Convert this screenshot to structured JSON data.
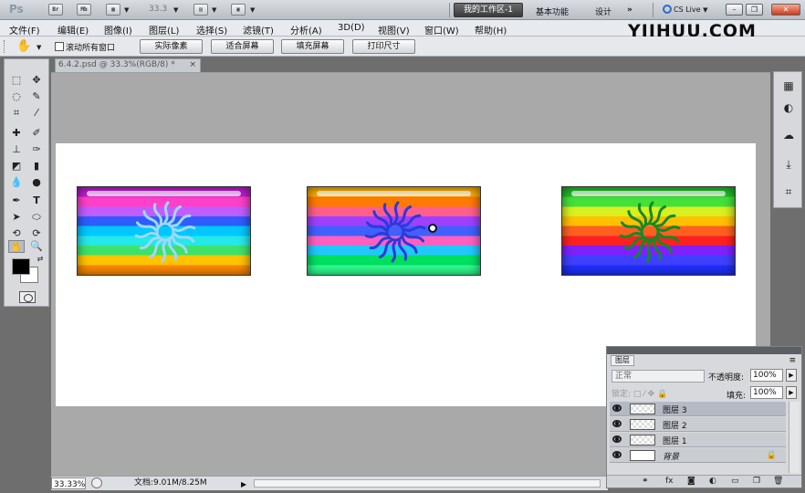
{
  "app": {
    "logo": "Ps",
    "zoom_dropdown": "33.3",
    "workspace_active": "我的工作区-1",
    "workspaces": [
      "基本功能",
      "设计"
    ],
    "overflow": "»",
    "cs_live": "CS Live"
  },
  "menu": [
    "文件(F)",
    "编辑(E)",
    "图像(I)",
    "图层(L)",
    "选择(S)",
    "滤镜(T)",
    "分析(A)",
    "3D(D)",
    "视图(V)",
    "窗口(W)",
    "帮助(H)"
  ],
  "watermark": "YIIHUU.COM",
  "options": {
    "scroll_all": "滚动所有窗口",
    "buttons": [
      "实际像素",
      "适合屏幕",
      "填充屏幕",
      "打印尺寸"
    ]
  },
  "document": {
    "tab_title": "6.4.2.psd @ 33.3%(RGB/8) *",
    "close": "×"
  },
  "flags": [
    {
      "name": "flag-1",
      "stripes": [
        "#c21cd6",
        "#ff40c8",
        "#c15cff",
        "#2e5cff",
        "#00c7ff",
        "#25e8e8",
        "#3de26a",
        "#ffc400",
        "#ff8a00"
      ],
      "sun_color": "#9fd8ff"
    },
    {
      "name": "flag-2",
      "stripes": [
        "#ffb000",
        "#ff7a00",
        "#ff5f8a",
        "#a040ff",
        "#4060ff",
        "#ff60c0",
        "#20c8ff",
        "#00e060",
        "#30ff90"
      ],
      "sun_color": "#2b3ad8"
    },
    {
      "name": "flag-3",
      "stripes": [
        "#20c02a",
        "#45e03a",
        "#d8f020",
        "#ffc000",
        "#ff6020",
        "#ff2020",
        "#8020ff",
        "#4040ff",
        "#2030ff"
      ],
      "sun_color": "#128a28"
    }
  ],
  "status": {
    "zoom": "33.33%",
    "doc": "文档:9.01M/8.25M"
  },
  "layers_panel": {
    "tab": "图层",
    "blend_mode": "正常",
    "opacity_label": "不透明度:",
    "opacity": "100%",
    "lock_label": "锁定:",
    "fill_label": "填充:",
    "fill": "100%",
    "layers": [
      {
        "name": "图层 3",
        "selected": true
      },
      {
        "name": "图层 2",
        "selected": false
      },
      {
        "name": "图层 1",
        "selected": false
      },
      {
        "name": "背景",
        "selected": false,
        "locked": true
      }
    ]
  }
}
